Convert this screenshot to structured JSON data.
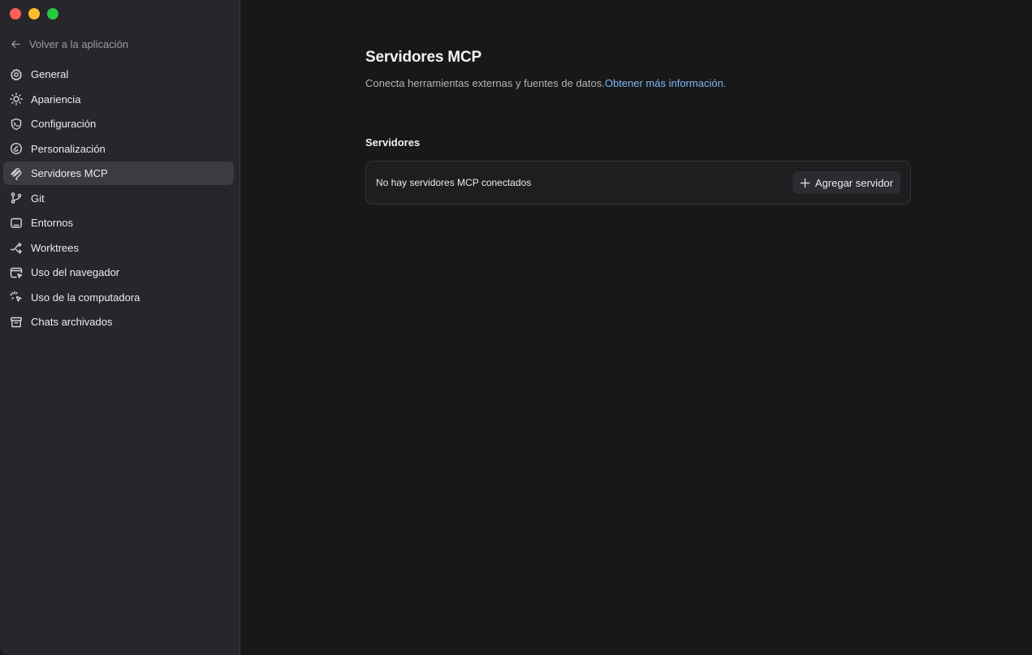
{
  "window": {
    "controls": [
      "close",
      "minimize",
      "zoom"
    ]
  },
  "sidebar": {
    "back_label": "Volver a la aplicación",
    "items": [
      {
        "label": "General",
        "icon": "gear-icon",
        "active": false
      },
      {
        "label": "Apariencia",
        "icon": "sun-icon",
        "active": false
      },
      {
        "label": "Configuración",
        "icon": "shield-terminal-icon",
        "active": false
      },
      {
        "label": "Personalización",
        "icon": "swirl-icon",
        "active": false
      },
      {
        "label": "Servidores MCP",
        "icon": "mcp-icon",
        "active": true
      },
      {
        "label": "Git",
        "icon": "git-branch-icon",
        "active": false
      },
      {
        "label": "Entornos",
        "icon": "monitor-icon",
        "active": false
      },
      {
        "label": "Worktrees",
        "icon": "worktree-icon",
        "active": false
      },
      {
        "label": "Uso del navegador",
        "icon": "browser-cursor-icon",
        "active": false
      },
      {
        "label": "Uso de la computadora",
        "icon": "pointer-click-icon",
        "active": false
      },
      {
        "label": "Chats archivados",
        "icon": "archive-icon",
        "active": false
      }
    ]
  },
  "main": {
    "title": "Servidores MCP",
    "subtitle": "Conecta herramientas externas y fuentes de datos.",
    "learn_more": "Obtener más información.",
    "section_title": "Servidores",
    "empty_text": "No hay servidores MCP conectados",
    "add_button": "Agregar servidor"
  },
  "colors": {
    "sidebar_bg": "#27272b",
    "main_bg": "#181819",
    "active_item_bg": "#3b3b40",
    "link": "#7fb6f5"
  }
}
